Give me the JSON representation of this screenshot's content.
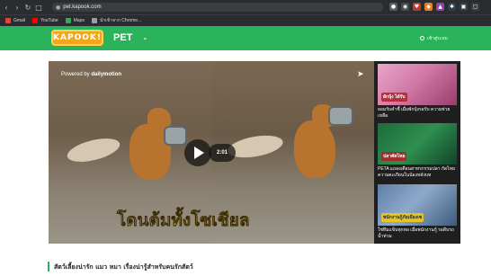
{
  "browser": {
    "url": "pet.kapook.com",
    "nav_icons": [
      "back-icon",
      "forward-icon",
      "reload-icon",
      "tab-icon"
    ],
    "bookmarks": [
      {
        "label": "Gmail",
        "icon": "gmail-icon",
        "color": "#ea4335"
      },
      {
        "label": "YouTube",
        "icon": "youtube-icon",
        "color": "#ff0000"
      },
      {
        "label": "Maps",
        "icon": "maps-icon",
        "color": "#34a853"
      },
      {
        "label": "นำเข้าจาก Chrome...",
        "icon": "folder-icon",
        "color": "#9aa0a6"
      }
    ]
  },
  "header": {
    "logo_text": "KAPOOK!",
    "title": "PET",
    "login_label": "เข้าสู่ระบบ",
    "brand_color": "#2bb35b"
  },
  "player": {
    "powered_by": "Powered by",
    "powered_brand": "dailymotion",
    "duration": "2:01",
    "caption_part1": "โดนต้ม",
    "caption_part2": "ทั้งโซเชียล"
  },
  "sidebar": {
    "items": [
      {
        "thumb_label": "ผักบุ้ง ได้รับ",
        "text": "ยอมรับคำชี้ เมื่อพักบุ้งรอรับ ความช่วยเหลือ"
      },
      {
        "thumb_label": "ปลาคัดไทย",
        "text": "PETA แถลงเตือนสาหรกรรมปลา กัดไทย ความตะเกียนในน้องหลังบท"
      },
      {
        "thumb_label": "พนักงานกู้ภัยเมืองเซ",
        "text": "ใช่ทีมแข็บทุกหอ เมื่อพนักงานกู้ รอดีบรถน้ำท่วม"
      }
    ]
  },
  "section": {
    "title": "สัตว์เลี้ยงน่ารัก แมว หมา เรื่องน่ารู้สำหรับคนรักสัตว์"
  }
}
